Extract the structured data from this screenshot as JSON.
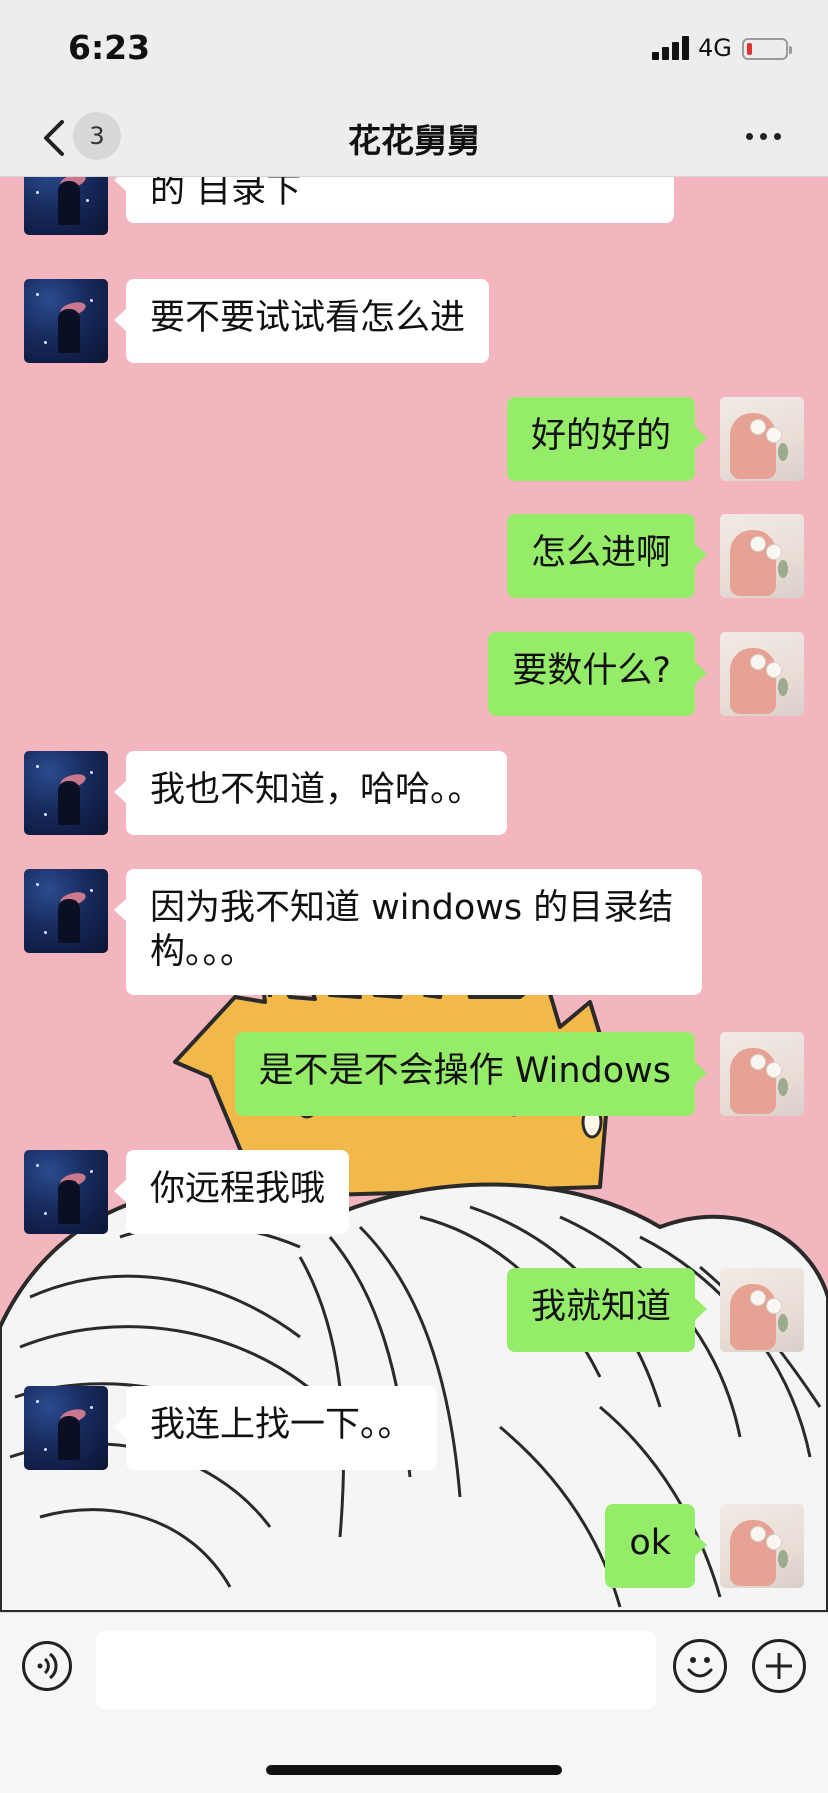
{
  "status_bar": {
    "time": "6:23",
    "network": "4G",
    "battery_color": "#e0332e"
  },
  "nav": {
    "back_icon": "chevron-left-icon",
    "unread_count": "3",
    "title": "花花舅舅",
    "more_icon": "ellipsis-icon"
  },
  "colors": {
    "chat_background": "#f4b6be",
    "incoming_bubble": "#ffffff",
    "outgoing_bubble": "#95ec69"
  },
  "messages": [
    {
      "sender": "friend",
      "text": "的 目录下"
    },
    {
      "sender": "friend",
      "text": "要不要试试看怎么进"
    },
    {
      "sender": "me",
      "text": "好的好的"
    },
    {
      "sender": "me",
      "text": "怎么进啊"
    },
    {
      "sender": "me",
      "text": "要数什么?"
    },
    {
      "sender": "friend",
      "text": "我也不知道，哈哈。。"
    },
    {
      "sender": "friend",
      "text": "因为我不知道 windows 的目录结构。。。"
    },
    {
      "sender": "me",
      "text": "是不是不会操作 Windows"
    },
    {
      "sender": "friend",
      "text": "你远程我哦"
    },
    {
      "sender": "me",
      "text": "我就知道"
    },
    {
      "sender": "friend",
      "text": "我连上找一下。。"
    },
    {
      "sender": "me",
      "text": "ok"
    }
  ],
  "input_bar": {
    "voice_icon": "voice-icon",
    "emoji_icon": "smiley-icon",
    "plus_icon": "plus-icon",
    "input_value": ""
  }
}
